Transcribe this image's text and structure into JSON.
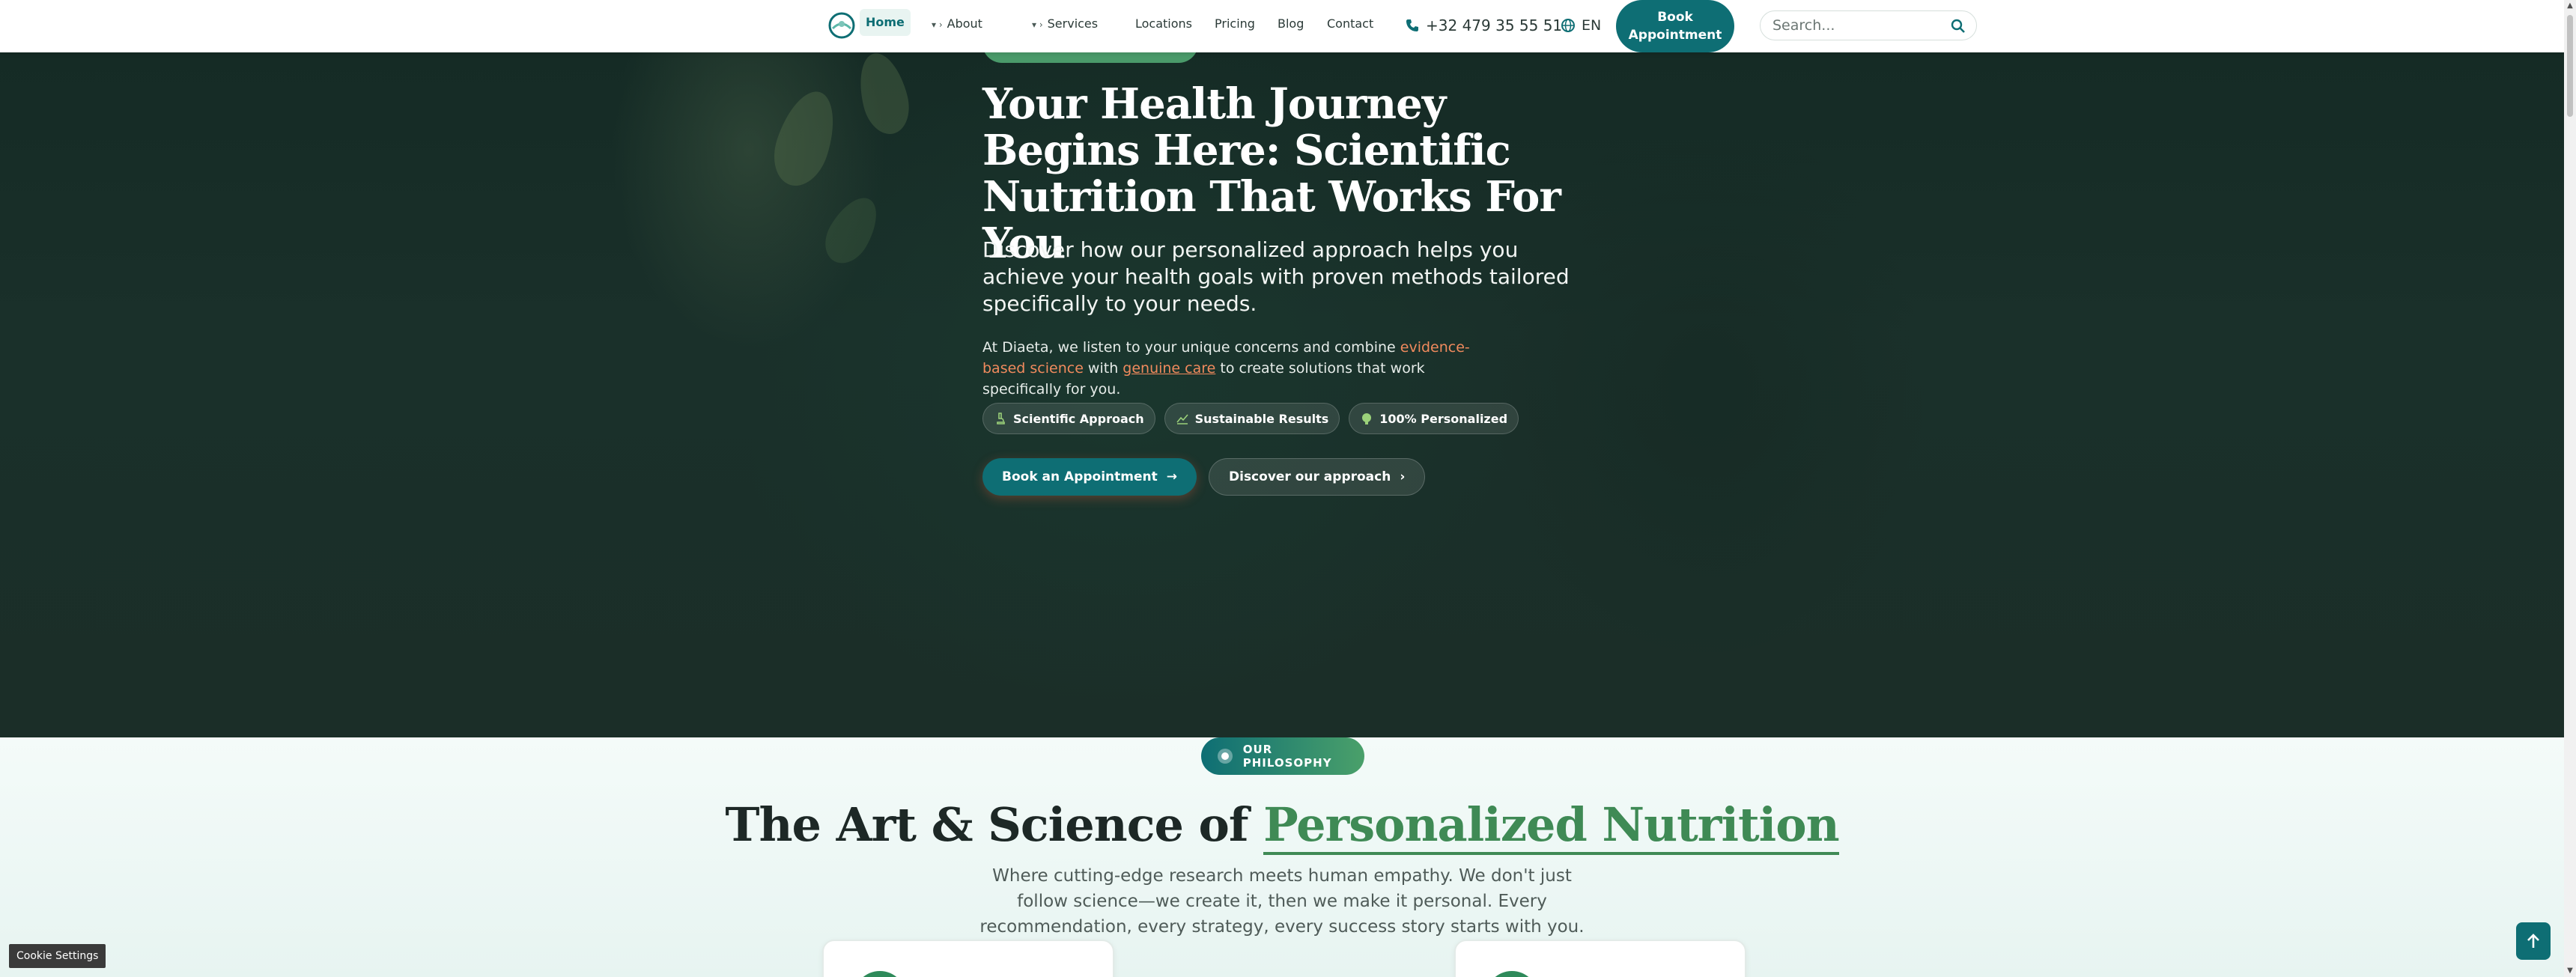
{
  "nav": {
    "home": "Home",
    "about": "About",
    "services": "Services",
    "locations": "Locations",
    "pricing": "Pricing",
    "blog": "Blog",
    "contact": "Contact",
    "phone": "+32 479 35 55 51",
    "language": "EN",
    "book_line1": "Book",
    "book_line2": "Appointment",
    "search_placeholder": "Search..."
  },
  "hero": {
    "title": "Your Health Journey Begins Here: Scientific Nutrition That Works For You",
    "subtitle": "Discover how our personalized approach helps you achieve your health goals with proven methods tailored specifically to your needs.",
    "para_start": "At Diaeta, we listen to your unique concerns and combine ",
    "para_highlight1": "evidence-based science",
    "para_mid": " with ",
    "para_highlight2": "genuine care",
    "para_end": " to create solutions that work specifically for you.",
    "pills": [
      "Scientific Approach",
      "Sustainable Results",
      "100% Personalized"
    ],
    "cta_primary": "Book an Appointment",
    "cta_secondary": "Discover our approach"
  },
  "philosophy": {
    "badge": "OUR PHILOSOPHY",
    "title_plain": "The Art & Science of ",
    "title_accent": "Personalized Nutrition",
    "description": "Where cutting-edge research meets human empathy. We don't just follow science—we create it, then we make it personal. Every recommendation, every strategy, every success story starts with you."
  },
  "cookie_settings": "Cookie Settings",
  "icons": {
    "logo": "diaeta-logo-icon",
    "phone": "phone-icon",
    "language": "globe-icon",
    "search": "search-icon",
    "back_to_top": "arrow-up-icon"
  },
  "colors": {
    "primary": "#0e6e74",
    "accent_green": "#3f8a55",
    "highlight_orange": "#f08a5d"
  }
}
